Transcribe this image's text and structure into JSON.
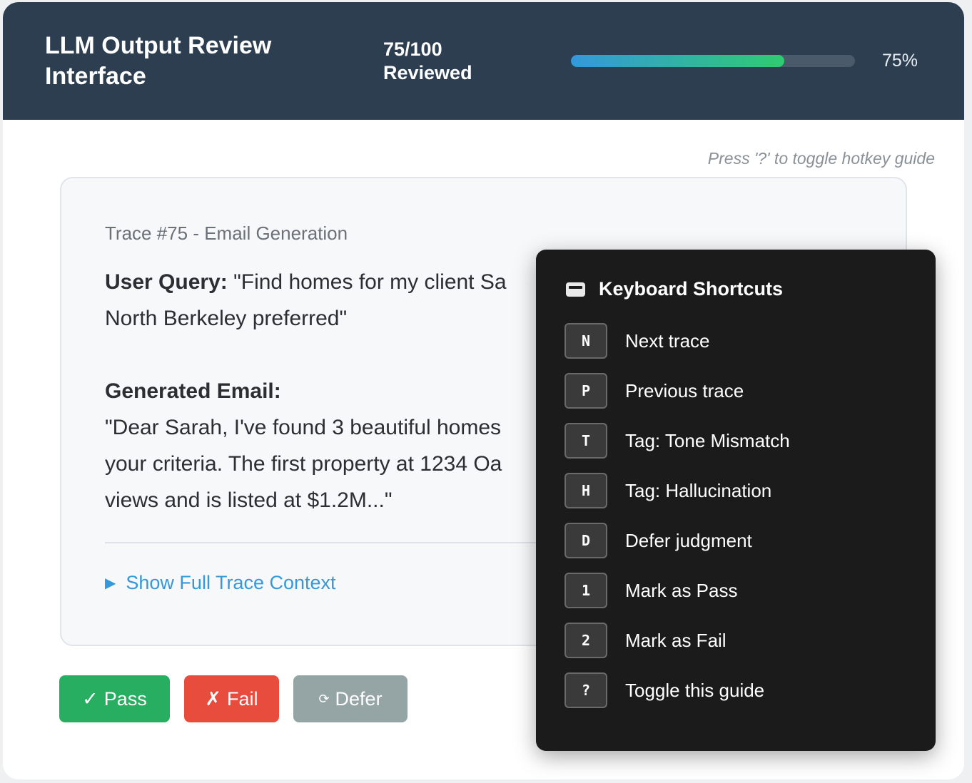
{
  "header": {
    "title": "LLM Output Review Interface",
    "counter": "75/100 Reviewed",
    "progress": 0.75,
    "percent_label": "75%"
  },
  "hint": "Press '?' to toggle hotkey guide",
  "trace": {
    "title": "Trace #75 - Email Generation",
    "user_query_label": "User Query:",
    "user_query": "\"Find homes for my client Sa",
    "user_query_line2": "North Berkeley preferred\"",
    "email_label": "Generated Email:",
    "email_lines": [
      "\"Dear Sarah, I've found 3 beautiful homes",
      "your criteria. The first property at 1234 Oa",
      "views and is listed at $1.2M...\""
    ],
    "expand_label": "Show Full Trace Context"
  },
  "actions": {
    "pass": {
      "icon": "✓",
      "label": "Pass"
    },
    "fail": {
      "icon": "✗",
      "label": "Fail"
    },
    "defer": {
      "icon": "⟳",
      "label": "Defer"
    }
  },
  "shortcuts": {
    "title": "Keyboard Shortcuts",
    "items": [
      {
        "key": "N",
        "label": "Next trace"
      },
      {
        "key": "P",
        "label": "Previous trace"
      },
      {
        "key": "T",
        "label": "Tag: Tone Mismatch"
      },
      {
        "key": "H",
        "label": "Tag: Hallucination"
      },
      {
        "key": "D",
        "label": "Defer judgment"
      },
      {
        "key": "1",
        "label": "Mark as Pass"
      },
      {
        "key": "2",
        "label": "Mark as Fail"
      },
      {
        "key": "?",
        "label": "Toggle this guide"
      }
    ]
  },
  "colors": {
    "header_bg": "#2c3e50",
    "pass": "#27ae60",
    "fail": "#e74c3c",
    "defer": "#95a5a6",
    "link": "#3498db"
  }
}
